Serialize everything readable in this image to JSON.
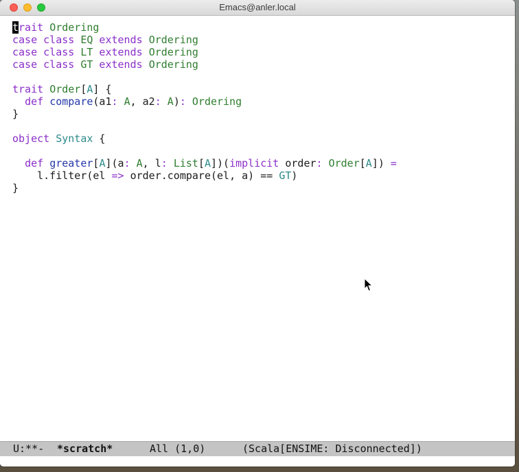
{
  "window": {
    "title": "Emacs@anler.local"
  },
  "editor": {
    "cursor_char": "t",
    "lines": [
      [
        {
          "c": "cursor",
          "t": "t"
        },
        {
          "c": "kw",
          "t": "rait "
        },
        {
          "c": "ty",
          "t": "Ordering"
        }
      ],
      [
        {
          "c": "kw",
          "t": "case class "
        },
        {
          "c": "ty",
          "t": "EQ"
        },
        {
          "c": "kw",
          "t": " extends "
        },
        {
          "c": "ty",
          "t": "Ordering"
        }
      ],
      [
        {
          "c": "kw",
          "t": "case class "
        },
        {
          "c": "ty",
          "t": "LT"
        },
        {
          "c": "kw",
          "t": " extends "
        },
        {
          "c": "ty",
          "t": "Ordering"
        }
      ],
      [
        {
          "c": "kw",
          "t": "case class "
        },
        {
          "c": "ty",
          "t": "GT"
        },
        {
          "c": "kw",
          "t": " extends "
        },
        {
          "c": "ty",
          "t": "Ordering"
        }
      ],
      [],
      [
        {
          "c": "kw",
          "t": "trait "
        },
        {
          "c": "ty",
          "t": "Order"
        },
        {
          "c": "pl",
          "t": "["
        },
        {
          "c": "tp",
          "t": "A"
        },
        {
          "c": "pl",
          "t": "] {"
        }
      ],
      [
        {
          "c": "pl",
          "t": "  "
        },
        {
          "c": "kw",
          "t": "def "
        },
        {
          "c": "fn",
          "t": "compare"
        },
        {
          "c": "pl",
          "t": "(a1"
        },
        {
          "c": "kw",
          "t": ": "
        },
        {
          "c": "ty",
          "t": "A"
        },
        {
          "c": "pl",
          "t": ", a2"
        },
        {
          "c": "kw",
          "t": ": "
        },
        {
          "c": "ty",
          "t": "A"
        },
        {
          "c": "pl",
          "t": ")"
        },
        {
          "c": "kw",
          "t": ": "
        },
        {
          "c": "ty",
          "t": "Ordering"
        }
      ],
      [
        {
          "c": "pl",
          "t": "}"
        }
      ],
      [],
      [
        {
          "c": "kw",
          "t": "object "
        },
        {
          "c": "tp",
          "t": "Syntax"
        },
        {
          "c": "pl",
          "t": " {"
        }
      ],
      [],
      [
        {
          "c": "pl",
          "t": "  "
        },
        {
          "c": "kw",
          "t": "def "
        },
        {
          "c": "fn",
          "t": "greater"
        },
        {
          "c": "pl",
          "t": "["
        },
        {
          "c": "tp",
          "t": "A"
        },
        {
          "c": "pl",
          "t": "](a"
        },
        {
          "c": "kw",
          "t": ": "
        },
        {
          "c": "ty",
          "t": "A"
        },
        {
          "c": "pl",
          "t": ", l"
        },
        {
          "c": "kw",
          "t": ": "
        },
        {
          "c": "ty",
          "t": "List"
        },
        {
          "c": "pl",
          "t": "["
        },
        {
          "c": "tp",
          "t": "A"
        },
        {
          "c": "pl",
          "t": "])("
        },
        {
          "c": "kw",
          "t": "implicit "
        },
        {
          "c": "pl",
          "t": "order"
        },
        {
          "c": "kw",
          "t": ": "
        },
        {
          "c": "ty",
          "t": "Order"
        },
        {
          "c": "pl",
          "t": "["
        },
        {
          "c": "tp",
          "t": "A"
        },
        {
          "c": "pl",
          "t": "]) "
        },
        {
          "c": "kw",
          "t": "="
        }
      ],
      [
        {
          "c": "pl",
          "t": "    l.filter(el "
        },
        {
          "c": "kw",
          "t": "=>"
        },
        {
          "c": "pl",
          "t": " order.compare(el, a) == "
        },
        {
          "c": "tp",
          "t": "GT"
        },
        {
          "c": "pl",
          "t": ")"
        }
      ],
      [
        {
          "c": "pl",
          "t": "}"
        }
      ]
    ]
  },
  "mode_line": {
    "status": "U:**-",
    "buffer": "*scratch*",
    "position": "All (1,0)",
    "mode": "(Scala[ENSIME: Disconnected])"
  },
  "colors": {
    "keyword": "#8b2fc9",
    "type": "#2f7d2f",
    "function": "#2438a8",
    "type_param": "#2d8a8a",
    "mode_line_bg": "#c4c4c4"
  }
}
